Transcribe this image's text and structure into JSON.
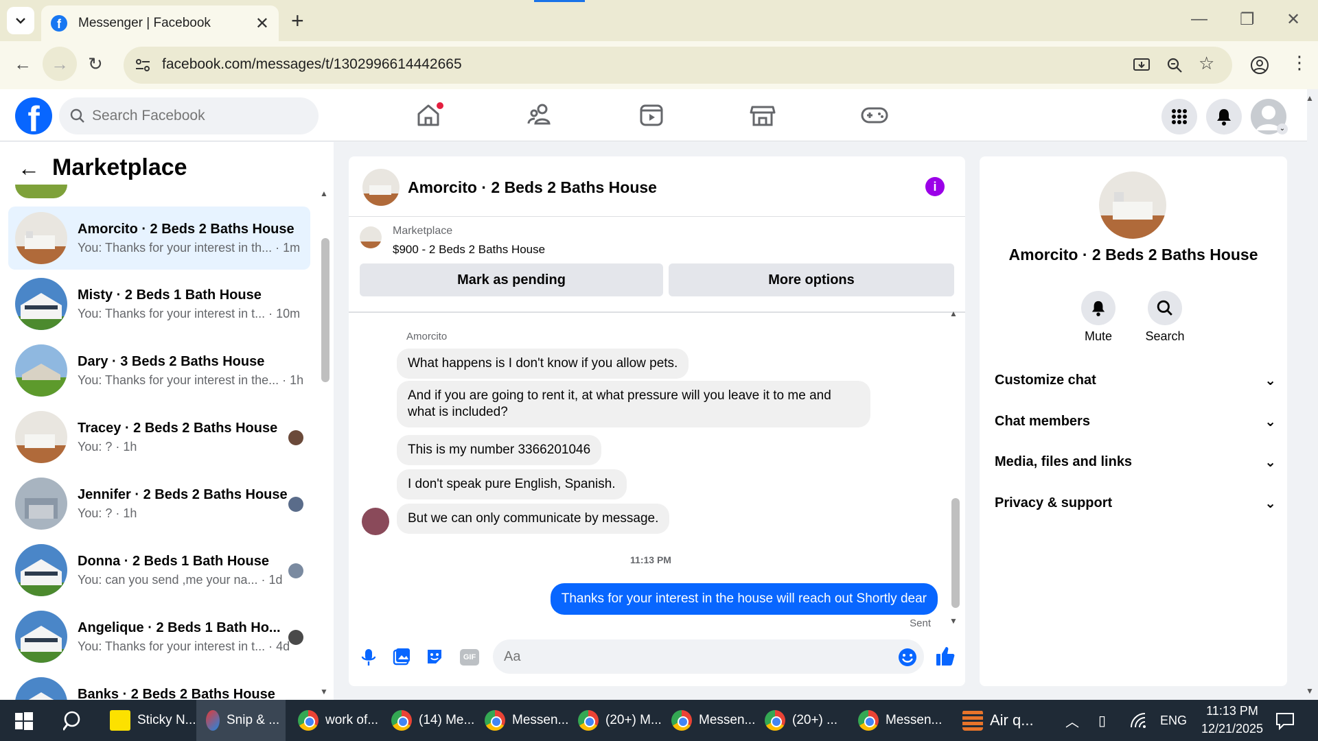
{
  "browser": {
    "tab_title": "Messenger | Facebook",
    "url": "facebook.com/messages/t/1302996614442665"
  },
  "fb": {
    "logo": "f",
    "search_placeholder": "Search Facebook"
  },
  "sidebar": {
    "title": "Marketplace",
    "conversations": [
      {
        "name": "Amorcito · 2 Beds 2 Baths House",
        "snippet": "You: Thanks for your interest in th... · 1m"
      },
      {
        "name": "Misty · 2 Beds 1 Bath House",
        "snippet": "You: Thanks for your interest in t... · 10m"
      },
      {
        "name": "Dary · 3 Beds 2 Baths House",
        "snippet": "You: Thanks for your interest in the... · 1h"
      },
      {
        "name": "Tracey · 2 Beds 2 Baths House",
        "snippet": "You: ? · 1h"
      },
      {
        "name": "Jennifer · 2 Beds 2 Baths House",
        "snippet": "You: ? · 1h"
      },
      {
        "name": "Donna · 2 Beds 1 Bath House",
        "snippet": "You: can you send ,me your na... · 1d"
      },
      {
        "name": "Angelique · 2 Beds 1 Bath Ho...",
        "snippet": "You: Thanks for your interest in t... · 4d"
      },
      {
        "name": "Banks · 2 Beds 2 Baths House",
        "snippet": ""
      }
    ]
  },
  "chat": {
    "title": "Amorcito · 2 Beds 2 Baths House",
    "listing_source": "Marketplace",
    "listing_title": "$900 - 2 Beds 2 Baths House",
    "mark_pending": "Mark as pending",
    "more_options": "More options",
    "sender_name": "Amorcito",
    "messages": [
      "What happens is I don't know if you allow pets.",
      "And if you are going to rent it, at what pressure will you leave it to me and what is included?",
      "This is my number  3366201046",
      "I don't speak pure English, Spanish.",
      "But we can only communicate by message."
    ],
    "timestamp": "11:13 PM",
    "outgoing": "Thanks for your interest in the house will reach out Shortly dear",
    "sent_status": "Sent",
    "composer_placeholder": "Aa"
  },
  "details": {
    "title": "Amorcito · 2 Beds 2 Baths House",
    "mute": "Mute",
    "search": "Search",
    "sections": [
      "Customize chat",
      "Chat members",
      "Media, files and links",
      "Privacy & support"
    ]
  },
  "taskbar": {
    "items": [
      "Sticky N...",
      "Snip & ...",
      "work of...",
      "(14) Me...",
      "Messen...",
      "(20+) M...",
      "Messen...",
      "(20+) ...",
      "Messen...",
      "Air q..."
    ],
    "lang": "ENG",
    "time": "11:13 PM",
    "date": "12/21/2025"
  },
  "colors": {
    "accent": "#0866ff",
    "info": "#9b00e8"
  }
}
